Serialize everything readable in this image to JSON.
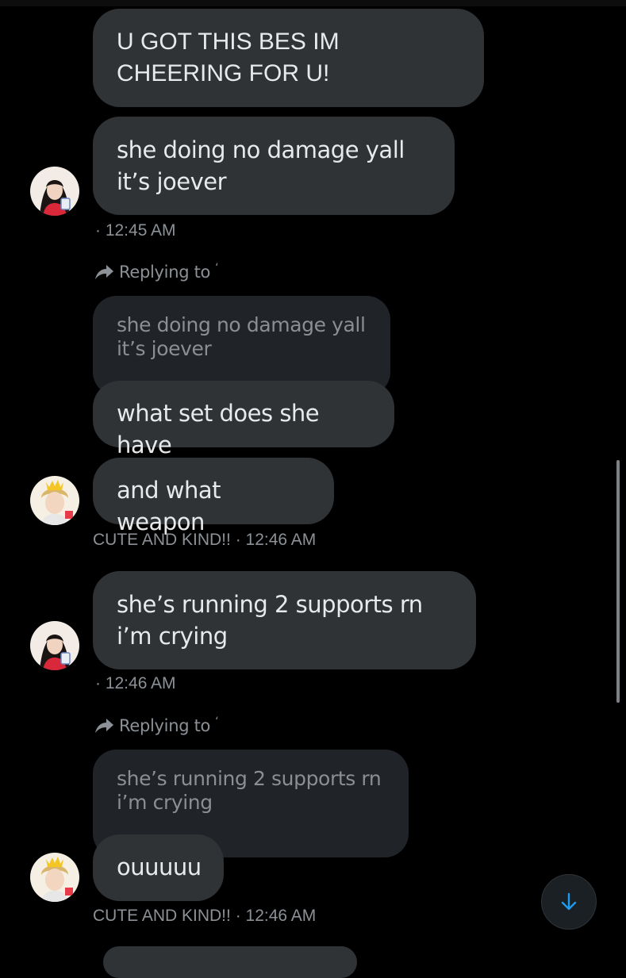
{
  "messages": [
    {
      "text": "U GOT THIS BES IM CHEERING FOR U!"
    },
    {
      "text": "she doing no damage yall it’s joever",
      "meta": "· 12:45 AM"
    },
    {
      "reply_label": "Replying to",
      "reply_handle": "‘",
      "quoted": "she doing no damage yall it’s joever",
      "text": "what set does she have"
    },
    {
      "text": "and what weapon",
      "meta": "CUTE AND KIND!! · 12:46 AM"
    },
    {
      "text": "she’s running 2 supports rn i’m crying",
      "meta": "· 12:46 AM"
    },
    {
      "reply_label": "Replying to",
      "reply_handle": "‘",
      "quoted": "she’s running 2 supports rn i’m crying",
      "text": "ouuuuu",
      "meta": "CUTE AND KIND!! · 12:46 AM"
    }
  ],
  "icons": {
    "reply": "reply-arrow-icon",
    "scroll_down": "arrow-down-icon"
  },
  "colors": {
    "background": "#000000",
    "bubble": "#2f3336",
    "quoted_bubble": "#202327",
    "meta_text": "#8b9196",
    "accent": "#1d9bf0"
  }
}
